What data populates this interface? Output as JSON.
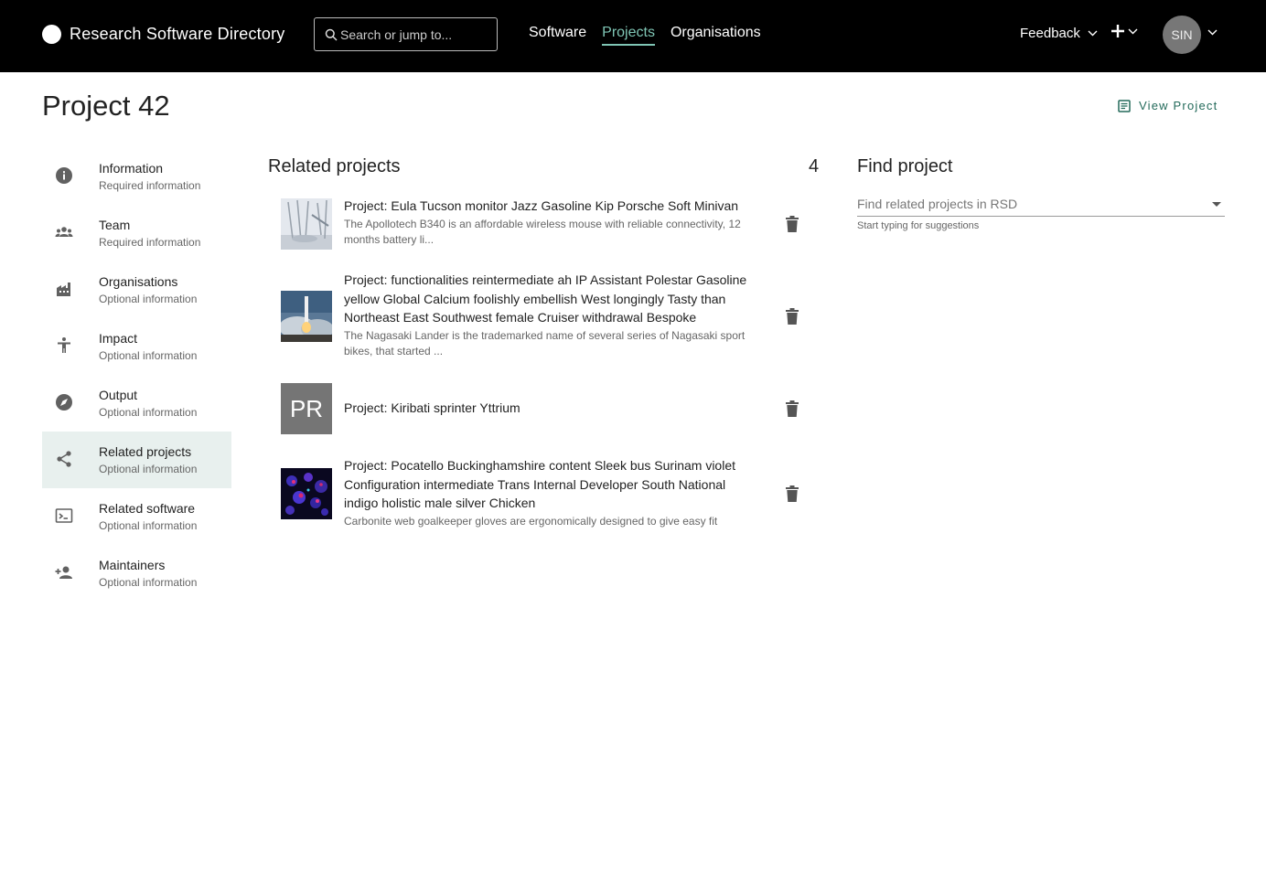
{
  "header": {
    "app_title": "Research Software Directory",
    "search_placeholder": "Search or jump to...",
    "nav": [
      {
        "label": "Software",
        "active": false
      },
      {
        "label": "Projects",
        "active": true
      },
      {
        "label": "Organisations",
        "active": false
      }
    ],
    "feedback_label": "Feedback",
    "avatar_initials": "SIN"
  },
  "page": {
    "title": "Project 42",
    "view_project_label": "View Project"
  },
  "sidebar": {
    "items": [
      {
        "label": "Information",
        "sub": "Required information",
        "icon": "info-icon"
      },
      {
        "label": "Team",
        "sub": "Required information",
        "icon": "team-icon"
      },
      {
        "label": "Organisations",
        "sub": "Optional information",
        "icon": "factory-icon"
      },
      {
        "label": "Impact",
        "sub": "Optional information",
        "icon": "accessibility-icon"
      },
      {
        "label": "Output",
        "sub": "Optional information",
        "icon": "explore-icon"
      },
      {
        "label": "Related projects",
        "sub": "Optional information",
        "icon": "share-icon",
        "active": true
      },
      {
        "label": "Related software",
        "sub": "Optional information",
        "icon": "terminal-icon"
      },
      {
        "label": "Maintainers",
        "sub": "Optional information",
        "icon": "person-add-icon"
      }
    ]
  },
  "related": {
    "title": "Related projects",
    "count": "4",
    "projects": [
      {
        "title": "Project: Eula Tucson monitor Jazz Gasoline Kip Porsche Soft Minivan",
        "description": "The Apollotech B340 is an affordable wireless mouse with reliable connectivity, 12 months battery li...",
        "thumb": "lab-glassware-image"
      },
      {
        "title": "Project: functionalities reintermediate ah IP Assistant Polestar Gasoline yellow Global Calcium foolishly embellish West longingly Tasty than Northeast East Southwest female Cruiser withdrawal Bespoke",
        "description": "The Nagasaki Lander is the trademarked name of several series of Nagasaki sport bikes, that started ...",
        "thumb": "rocket-launch-image"
      },
      {
        "title": "Project: Kiribati sprinter Yttrium",
        "description": "",
        "thumb_initials": "PR"
      },
      {
        "title": "Project: Pocatello Buckinghamshire content Sleek bus Surinam violet Configuration intermediate Trans Internal Developer South National indigo holistic male silver Chicken",
        "description": "Carbonite web goalkeeper gloves are ergonomically designed to give easy fit",
        "thumb": "microscopy-cells-image"
      }
    ]
  },
  "find": {
    "title": "Find project",
    "placeholder": "Find related projects in RSD",
    "helper": "Start typing for suggestions"
  },
  "colors": {
    "header_bg": "#000000",
    "accent": "#7fc5b4",
    "link": "#236a5a",
    "active_bg": "#e8f0ee"
  }
}
